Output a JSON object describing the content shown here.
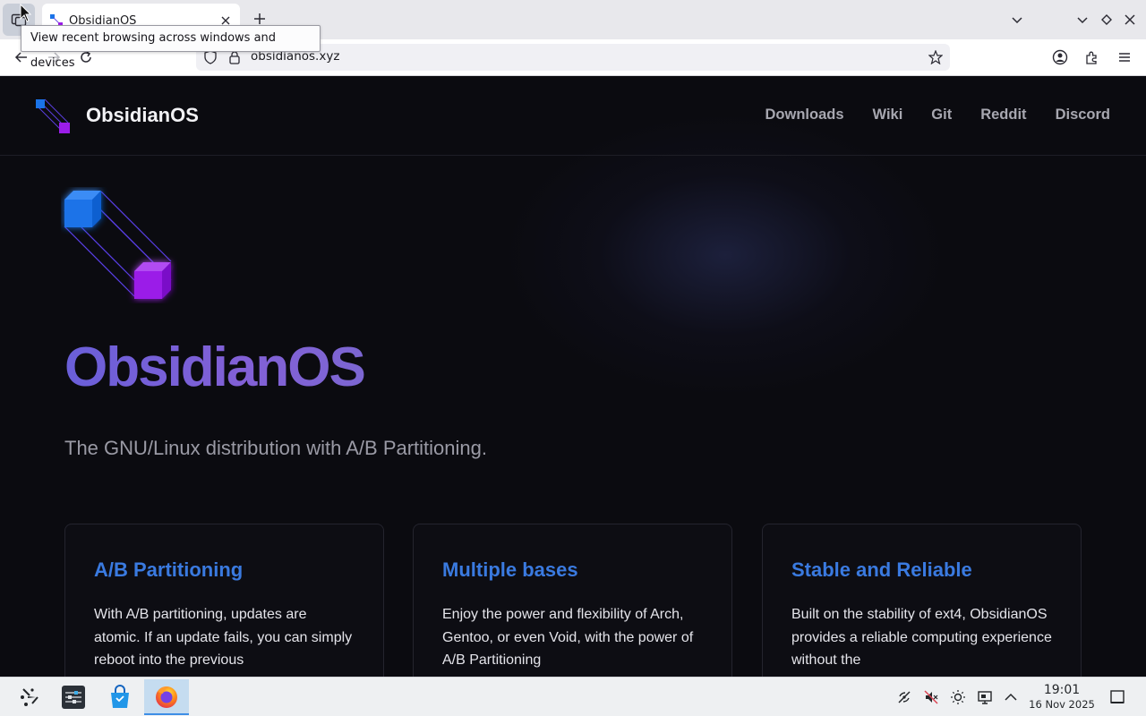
{
  "browser": {
    "tab": {
      "title": "ObsidianOS"
    },
    "tooltip": "View recent browsing across windows and devices",
    "url": "obsidianos.xyz"
  },
  "site": {
    "name": "ObsidianOS",
    "nav": [
      "Downloads",
      "Wiki",
      "Git",
      "Reddit",
      "Discord"
    ],
    "hero": {
      "title": "ObsidianOS",
      "subtitle": "The GNU/Linux distribution with A/B Partitioning."
    },
    "cards": [
      {
        "title": "A/B Partitioning",
        "body": "With A/B partitioning, updates are atomic. If an update fails, you can simply reboot into the previous"
      },
      {
        "title": "Multiple bases",
        "body": "Enjoy the power and flexibility of Arch, Gentoo, or even Void, with the power of A/B Partitioning"
      },
      {
        "title": "Stable and Reliable",
        "body": "Built on the stability of ext4, ObsidianOS provides a reliable computing experience without the"
      }
    ],
    "colors": {
      "background": "#0b0b10",
      "card_title": "#3a7ae0",
      "hero_gradient": "#7a62d8",
      "logo_blue": "#1a73e8",
      "logo_purple": "#9b1de8"
    }
  },
  "taskbar": {
    "clock": {
      "time": "19:01",
      "date": "16 Nov 2025"
    },
    "apps": [
      "application-launcher-icon",
      "system-settings-icon",
      "discover-store-icon",
      "firefox-icon"
    ],
    "tray": [
      "network-icon",
      "volume-muted-icon",
      "brightness-icon",
      "display-icon",
      "tray-expand-icon",
      "show-desktop-icon"
    ]
  }
}
